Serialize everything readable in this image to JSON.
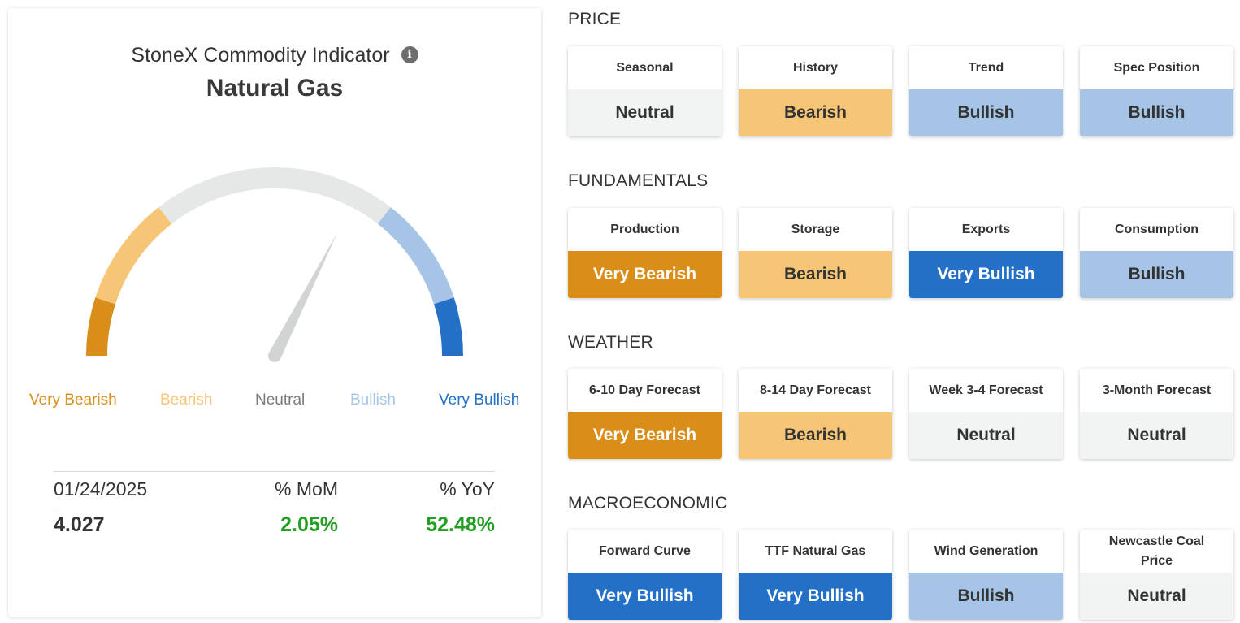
{
  "indicator": {
    "title": "StoneX Commodity Indicator",
    "commodity": "Natural Gas",
    "info_icon": "info-icon",
    "gauge_value": 0.65,
    "scale": [
      {
        "label": "Very Bearish",
        "color": "#d98e1a"
      },
      {
        "label": "Bearish",
        "color": "#f6c676"
      },
      {
        "label": "Neutral",
        "color": "#e6e8e7"
      },
      {
        "label": "Bullish",
        "color": "#a6c5e6"
      },
      {
        "label": "Very Bullish",
        "color": "#2370c6"
      }
    ],
    "legend_colors": [
      "#d98e1a",
      "#f6c676",
      "#7a7a7a",
      "#a6c5e6",
      "#2370c6"
    ],
    "stats": {
      "date": "01/24/2025",
      "mom_label": "% MoM",
      "yoy_label": "% YoY",
      "price": "4.027",
      "mom": "2.05%",
      "yoy": "52.48%"
    }
  },
  "rating_styles": {
    "Very Bearish": {
      "bg": "#d98e1a",
      "fg": "#ffffff"
    },
    "Bearish": {
      "bg": "#f6c676",
      "fg": "#333333"
    },
    "Neutral": {
      "bg": "#f2f3f3",
      "fg": "#333333"
    },
    "Bullish": {
      "bg": "#a6c5e6",
      "fg": "#333333"
    },
    "Very Bullish": {
      "bg": "#2370c6",
      "fg": "#ffffff"
    }
  },
  "sections": [
    {
      "title": "PRICE",
      "tiles": [
        {
          "label": "Seasonal",
          "value": "Neutral"
        },
        {
          "label": "History",
          "value": "Bearish"
        },
        {
          "label": "Trend",
          "value": "Bullish"
        },
        {
          "label": "Spec Position",
          "value": "Bullish"
        }
      ]
    },
    {
      "title": "FUNDAMENTALS",
      "tiles": [
        {
          "label": "Production",
          "value": "Very Bearish"
        },
        {
          "label": "Storage",
          "value": "Bearish"
        },
        {
          "label": "Exports",
          "value": "Very Bullish"
        },
        {
          "label": "Consumption",
          "value": "Bullish"
        }
      ]
    },
    {
      "title": "WEATHER",
      "tiles": [
        {
          "label": "6-10 Day Forecast",
          "value": "Very Bearish"
        },
        {
          "label": "8-14 Day Forecast",
          "value": "Bearish"
        },
        {
          "label": "Week 3-4 Forecast",
          "value": "Neutral"
        },
        {
          "label": "3-Month Forecast",
          "value": "Neutral"
        }
      ]
    },
    {
      "title": "MACROECONOMIC",
      "tiles": [
        {
          "label": "Forward Curve",
          "value": "Very Bullish"
        },
        {
          "label": "TTF Natural Gas",
          "value": "Very Bullish"
        },
        {
          "label": "Wind Generation",
          "value": "Bullish"
        },
        {
          "label": "Newcastle Coal Price",
          "value": "Neutral"
        }
      ]
    }
  ]
}
